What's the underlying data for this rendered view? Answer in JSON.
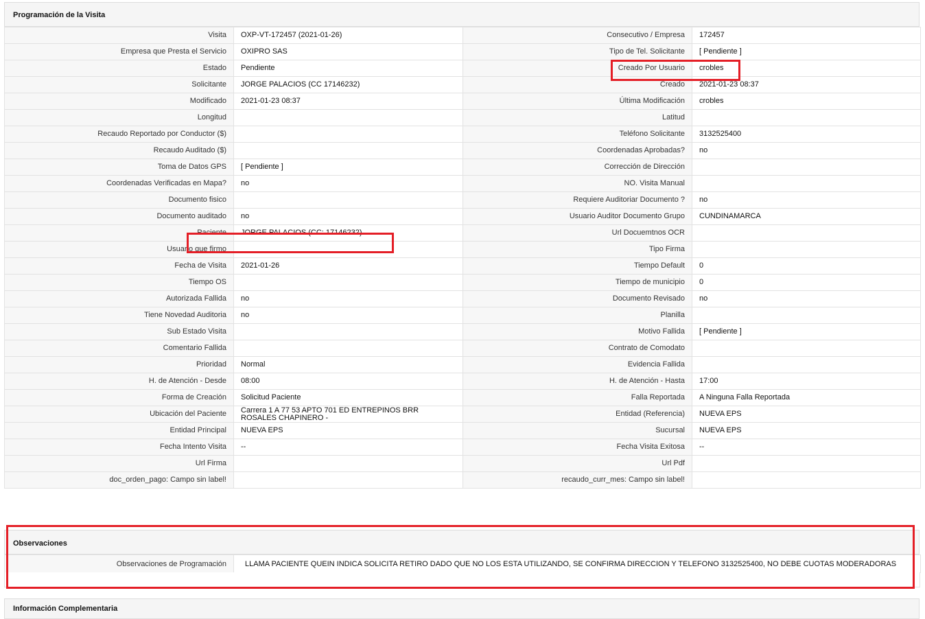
{
  "programacion": {
    "title": "Programación de la Visita",
    "rows": [
      [
        {
          "label": "Visita",
          "value": "OXP-VT-172457 (2021-01-26)"
        },
        {
          "label": "Consecutivo / Empresa",
          "value": "172457"
        }
      ],
      [
        {
          "label": "Empresa que Presta el Servicio",
          "value": "OXIPRO SAS"
        },
        {
          "label": "Tipo de Tel. Solicitante",
          "value": "[ Pendiente ]"
        }
      ],
      [
        {
          "label": "Estado",
          "value": "Pendiente"
        },
        {
          "label": "Creado Por Usuario",
          "value": "crobles"
        }
      ],
      [
        {
          "label": "Solicitante",
          "value": "JORGE PALACIOS (CC 17146232)"
        },
        {
          "label": "Creado",
          "value": "2021-01-23 08:37"
        }
      ],
      [
        {
          "label": "Modificado",
          "value": "2021-01-23 08:37"
        },
        {
          "label": "Última Modificación",
          "value": " crobles"
        }
      ],
      [
        {
          "label": "Longitud",
          "value": ""
        },
        {
          "label": "Latitud",
          "value": ""
        }
      ],
      [
        {
          "label": "Recaudo Reportado por Conductor ($)",
          "value": ""
        },
        {
          "label": "Teléfono Solicitante",
          "value": "3132525400"
        }
      ],
      [
        {
          "label": "Recaudo Auditado ($)",
          "value": ""
        },
        {
          "label": "Coordenadas Aprobadas?",
          "value": " no"
        }
      ],
      [
        {
          "label": "Toma de Datos GPS",
          "value": "[ Pendiente ]"
        },
        {
          "label": "Corrección de Dirección",
          "value": ""
        }
      ],
      [
        {
          "label": "Coordenadas Verificadas en Mapa?",
          "value": " no"
        },
        {
          "label": "NO. Visita Manual",
          "value": ""
        }
      ],
      [
        {
          "label": "Documento fisico",
          "value": ""
        },
        {
          "label": "Requiere Auditoriar Documento ?",
          "value": " no"
        }
      ],
      [
        {
          "label": "Documento auditado",
          "value": " no"
        },
        {
          "label": "Usuario Auditor Documento Grupo",
          "value": "CUNDINAMARCA"
        }
      ],
      [
        {
          "label": "Paciente",
          "value": "JORGE PALACIOS (CC: 17146232)"
        },
        {
          "label": "Url Docuemtnos OCR",
          "value": ""
        }
      ],
      [
        {
          "label": "Usuario que firmo",
          "value": ""
        },
        {
          "label": "Tipo Firma",
          "value": ""
        }
      ],
      [
        {
          "label": "Fecha de Visita",
          "value": " 2021-01-26"
        },
        {
          "label": "Tiempo Default",
          "value": "0"
        }
      ],
      [
        {
          "label": "Tiempo OS",
          "value": ""
        },
        {
          "label": "Tiempo de municipio",
          "value": "0"
        }
      ],
      [
        {
          "label": "Autorizada Fallida",
          "value": " no"
        },
        {
          "label": "Documento Revisado",
          "value": " no"
        }
      ],
      [
        {
          "label": "Tiene Novedad Auditoria",
          "value": " no"
        },
        {
          "label": "Planilla",
          "value": ""
        }
      ],
      [
        {
          "label": "Sub Estado Visita",
          "value": ""
        },
        {
          "label": "Motivo Fallida",
          "value": "[ Pendiente ]"
        }
      ],
      [
        {
          "label": "Comentario Fallida",
          "value": ""
        },
        {
          "label": "Contrato de Comodato",
          "value": ""
        }
      ],
      [
        {
          "label": "Prioridad",
          "value": "Normal"
        },
        {
          "label": "Evidencia Fallida",
          "value": ""
        }
      ],
      [
        {
          "label": "H. de Atención - Desde",
          "value": "08:00"
        },
        {
          "label": "H. de Atención - Hasta",
          "value": "17:00"
        }
      ],
      [
        {
          "label": "Forma de Creación",
          "value": "Solicitud Paciente"
        },
        {
          "label": "Falla Reportada",
          "value": "A Ninguna Falla Reportada"
        }
      ],
      [
        {
          "label": "Ubicación del Paciente",
          "value": "Carrera 1 A 77 53 APTO 701 ED ENTREPINOS BRR ROSALES CHAPINERO -"
        },
        {
          "label": "Entidad (Referencia)",
          "value": "NUEVA EPS"
        }
      ],
      [
        {
          "label": "Entidad Principal",
          "value": "NUEVA EPS"
        },
        {
          "label": "Sucursal",
          "value": "NUEVA EPS"
        }
      ],
      [
        {
          "label": "Fecha Intento Visita",
          "value": " --"
        },
        {
          "label": "Fecha Visita Exitosa",
          "value": " --"
        }
      ],
      [
        {
          "label": "Url Firma",
          "value": ""
        },
        {
          "label": "Url Pdf",
          "value": ""
        }
      ],
      [
        {
          "label": "doc_orden_pago: Campo sin label!",
          "value": ""
        },
        {
          "label": "recaudo_curr_mes: Campo sin label!",
          "value": ""
        }
      ]
    ]
  },
  "observaciones": {
    "title": "Observaciones",
    "label": "Observaciones de Programación",
    "value": "LLAMA PACIENTE QUEIN INDICA SOLICITA RETIRO DADO QUE NO LOS ESTA UTILIZANDO, SE CONFIRMA DIRECCION Y TELEFONO 3132525400, NO DEBE CUOTAS MODERADORAS"
  },
  "complementaria": {
    "title": "Información Complementaria"
  },
  "highlight_color": "#e41e26"
}
